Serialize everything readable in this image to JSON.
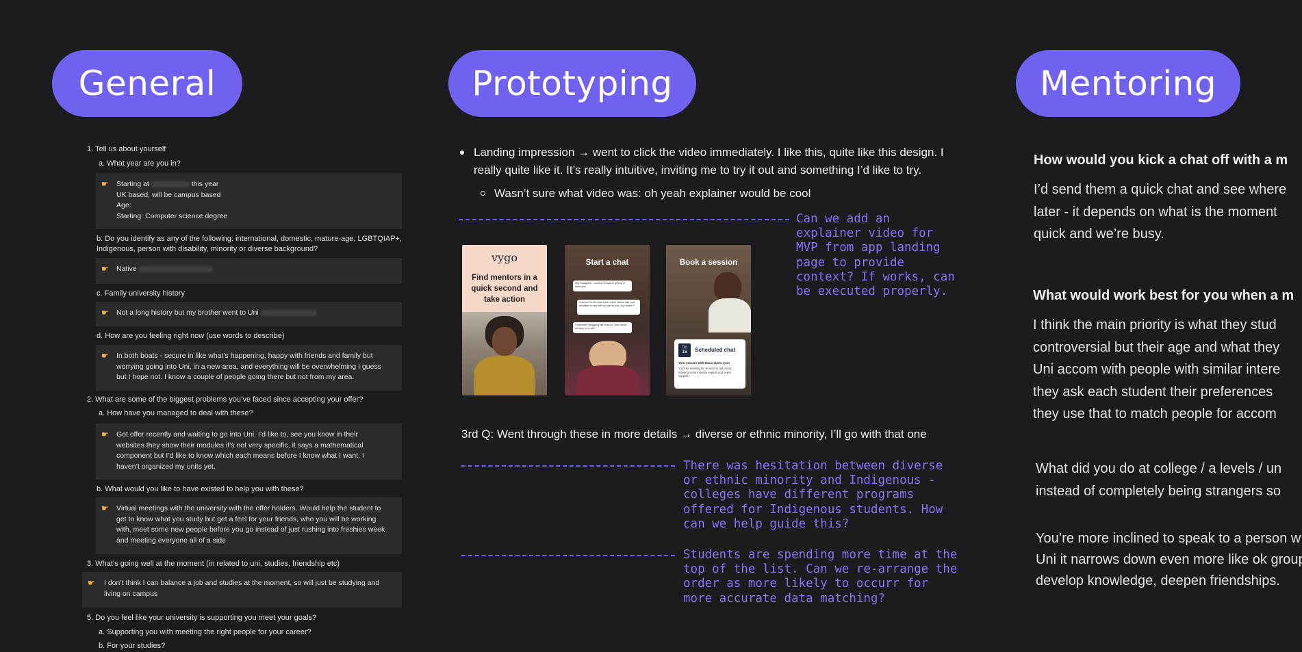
{
  "headers": {
    "general": "General",
    "prototyping": "Prototyping",
    "mentoring": "Mentoring"
  },
  "general": {
    "q1": "1.  Tell us about yourself",
    "q1a": "a.  What year are you in?",
    "box1": [
      "Starting at",
      "this year",
      "UK based, will be campus based",
      "Age:",
      "Starting: Computer science degree"
    ],
    "q1b_1": "b. Do you identify as any of the following: international, domestic, mature-age, LGBTQIAP+,",
    "q1b_2": "Indigenous, person with disability, minority or diverse background?",
    "box2": "Native",
    "q1c": "c. Family university history",
    "box3": "Not a long history but my brother went to Uni",
    "q1d": "d. How are you feeling right now (use words to describe)",
    "box4": [
      "In both boats - secure in like what’s happening, happy with friends and family but",
      "worrying going into Uni, in a new area, and everything will be overwhelming I guess",
      "but I hope not. I know a couple of people going there but not from my area."
    ],
    "q2": "2.  What are some of the biggest problems you’ve faced since accepting your offer?",
    "q2a": "a.  How have you managed to deal with these?",
    "box5": [
      "Got offer recently and waiting to go into Uni. I’d like to, see you know in their",
      "websites they show their modules it’s not very specific, it says a mathematical",
      "component but I’d like to know which each means before I know what I want. I",
      "haven’t organized my units yet."
    ],
    "q2b": "b. What would you like to have existed to help you with these?",
    "box6": [
      "Virtual meetings with the university with the offer holders. Would help the student to",
      "get to know what you study but get a feel for your friends, who you will be working",
      "with, meet some new people before you go instead of just rushing into freshies week",
      "and meeting everyone all of a side"
    ],
    "q3": "3.  What’s going well at the moment (in related to uni, studies, friendship etc)",
    "box7": [
      "I don’t think I can balance a job and studies at the moment, so will just be studying and",
      "living on campus"
    ],
    "q5": "5.  Do you feel like your university is supporting you meet your goals?",
    "q5a": "a.  Supporting you with meeting the right people for your career?",
    "q5b": "b.  For your studies?"
  },
  "prototyping": {
    "bullet1_l1": "Landing impression → went to click the video immediately. I like this, quite like this design. I",
    "bullet1_l2": "really quite like it. It’s really intuitive, inviting me to try it out and something I’d like to try.",
    "sub_bullet": "Wasn’t sure what video was: oh yeah explainer would be cool",
    "note1": [
      "Can we add an",
      "explainer video for",
      "MVP from app landing",
      "page to provide",
      "context? If works, can",
      "be executed properly."
    ],
    "screen1": {
      "logo": "vygo",
      "title": "Find mentors in a quick second and take action"
    },
    "screen2": {
      "title": "Start a chat",
      "msgs": [
        "Hey Kawagana · Looking forward to getting to know you!",
        "Hi Anna! I’m not sure which units I should take next semester to help with my career plan. Any advice?",
        "I remember struggling with that too. More about we jump on a call?"
      ]
    },
    "screen3": {
      "title": "Book a session",
      "card_title": "Scheduled chat",
      "card_sub": "Your session with Elana starts soon",
      "card_body": "You’ll be meeting for 30 mins to talk about meeting some industry experts and event support.",
      "badge_top": "Tue",
      "badge_num": "18"
    },
    "q3_line": "3rd Q: Went through these in more details → diverse or ethnic minority, I’ll go with that one",
    "note2": [
      "There was hesitation between diverse",
      "or ethnic minority and Indigenous -",
      "colleges have different programs",
      "offered for Indigenous students. How",
      "can we help guide this?"
    ],
    "note3": [
      "Students are spending more time at the",
      "top of the list. Can we re-arrange the",
      "order as more likely to occurr for",
      "more accurate data matching?"
    ]
  },
  "mentoring": {
    "q1": "How would you kick a chat off with a m",
    "a1": [
      "I’d send them a quick chat and see where",
      "later - it depends on what is the moment",
      "quick and we’re busy."
    ],
    "q2": "What would work best for you when a m",
    "a2": [
      "I think the main priority is what they stud",
      "controversial but their age and what they",
      "Uni accom with people with similar intere",
      "they ask each student their preferences",
      "they use that to match people for accom"
    ],
    "p3": [
      "What did you do at college / a levels / un",
      "instead of completely being strangers so"
    ],
    "p4": [
      "You’re more inclined to speak to a person w",
      "Uni it narrows down even more like ok group",
      "develop knowledge, deepen friendships."
    ]
  }
}
